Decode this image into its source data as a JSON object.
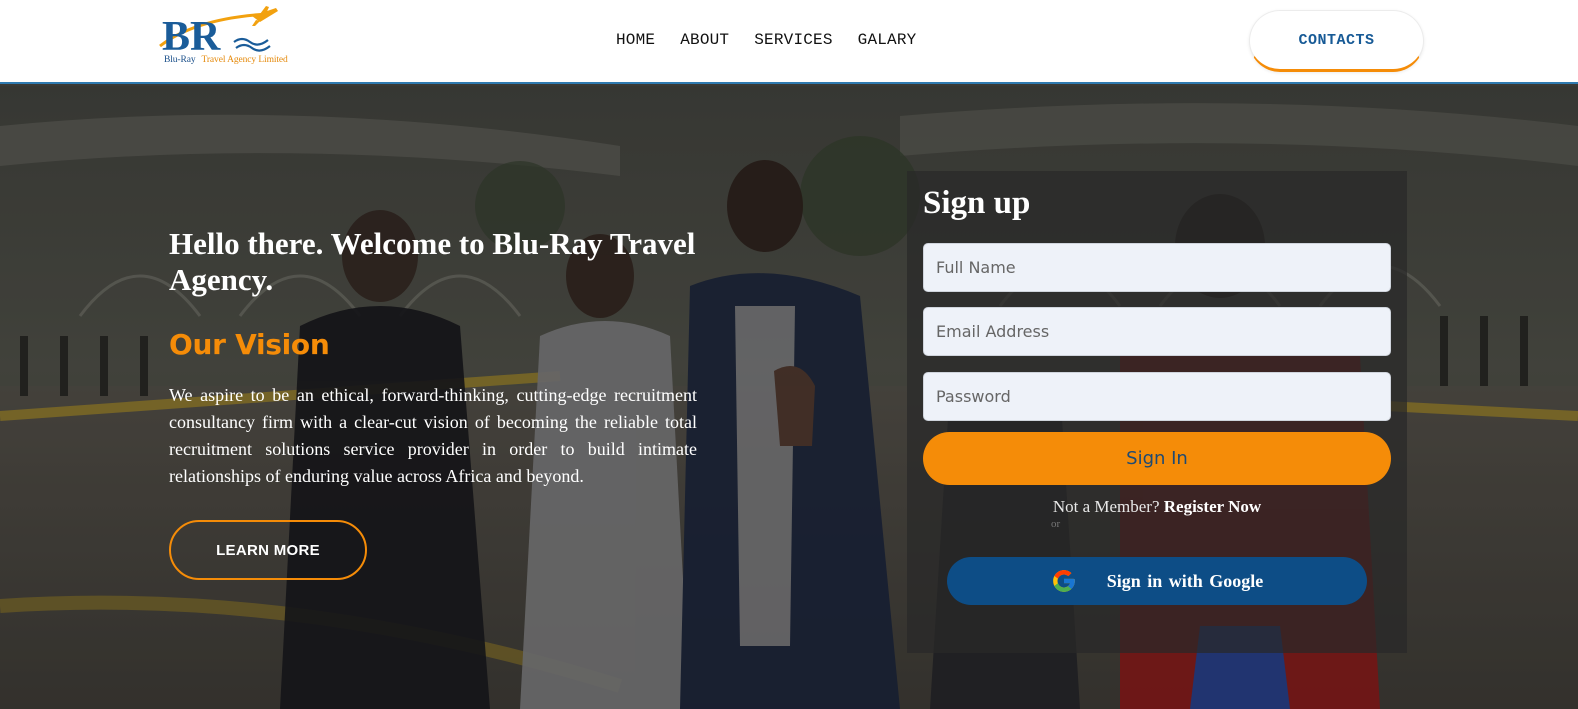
{
  "brand": {
    "logo_letters": "BR",
    "tagline_name": "Blu-Ray",
    "tagline_rest": "Travel Agency Limited"
  },
  "nav": {
    "items": [
      "HOME",
      "ABOUT",
      "SERVICES",
      "GALARY"
    ],
    "contacts_label": "CONTACTS"
  },
  "hero": {
    "welcome": "Hello there. Welcome to Blu-Ray Travel Agency.",
    "vision_heading": "Our Vision",
    "vision_text": "We aspire to be an ethical, forward-thinking, cutting-edge recruitment consultancy firm with a clear-cut vision of becoming the reliable total recruitment solutions service provider in order to build intimate relationships of enduring value across Africa and beyond.",
    "learn_more": "LEARN MORE"
  },
  "signup": {
    "title": "Sign up",
    "full_name_placeholder": "Full Name",
    "email_placeholder": "Email Address",
    "password_placeholder": "Password",
    "signin_label": "Sign In",
    "not_member": "Not a Member?",
    "register": "Register Now",
    "or": "or",
    "google_label": "Sign in with Google"
  },
  "colors": {
    "accent_orange": "#f58c08",
    "brand_blue": "#175a96",
    "google_button": "#0d4d86"
  }
}
